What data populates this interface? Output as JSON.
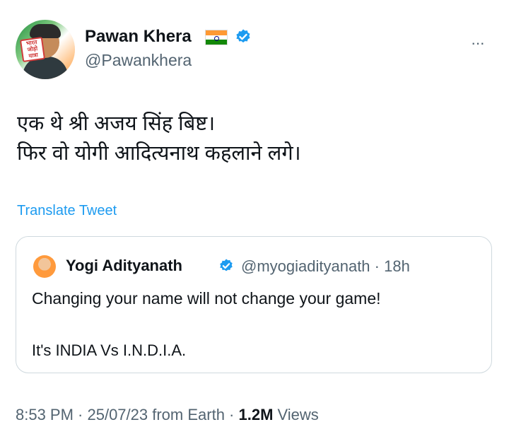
{
  "author": {
    "name": "Pawan Khera",
    "handle": "@Pawankhera",
    "avatar_badge": "भारत जोड़ो यात्रा",
    "flag_icon": "india-flag-icon",
    "verified_icon": "verified-badge-icon",
    "verified_color": "#1d9bf0"
  },
  "more_label": "···",
  "tweet": {
    "lines": [
      "एक थे श्री अजय सिंह बिष्ट।",
      "फिर वो योगी आदित्यनाथ कहलाने लगे।"
    ],
    "translate_label": "Translate Tweet"
  },
  "quoted": {
    "name": "Yogi Adityanath",
    "handle_time": "@myogiadityanath · 18h",
    "line1": "Changing your name will not change your game!",
    "line2": "It's INDIA Vs I.N.D.I.A."
  },
  "meta": {
    "time": "8:53 PM · 25/07/23 from Earth · ",
    "views_count": "1.2M",
    "views_label": " Views"
  }
}
